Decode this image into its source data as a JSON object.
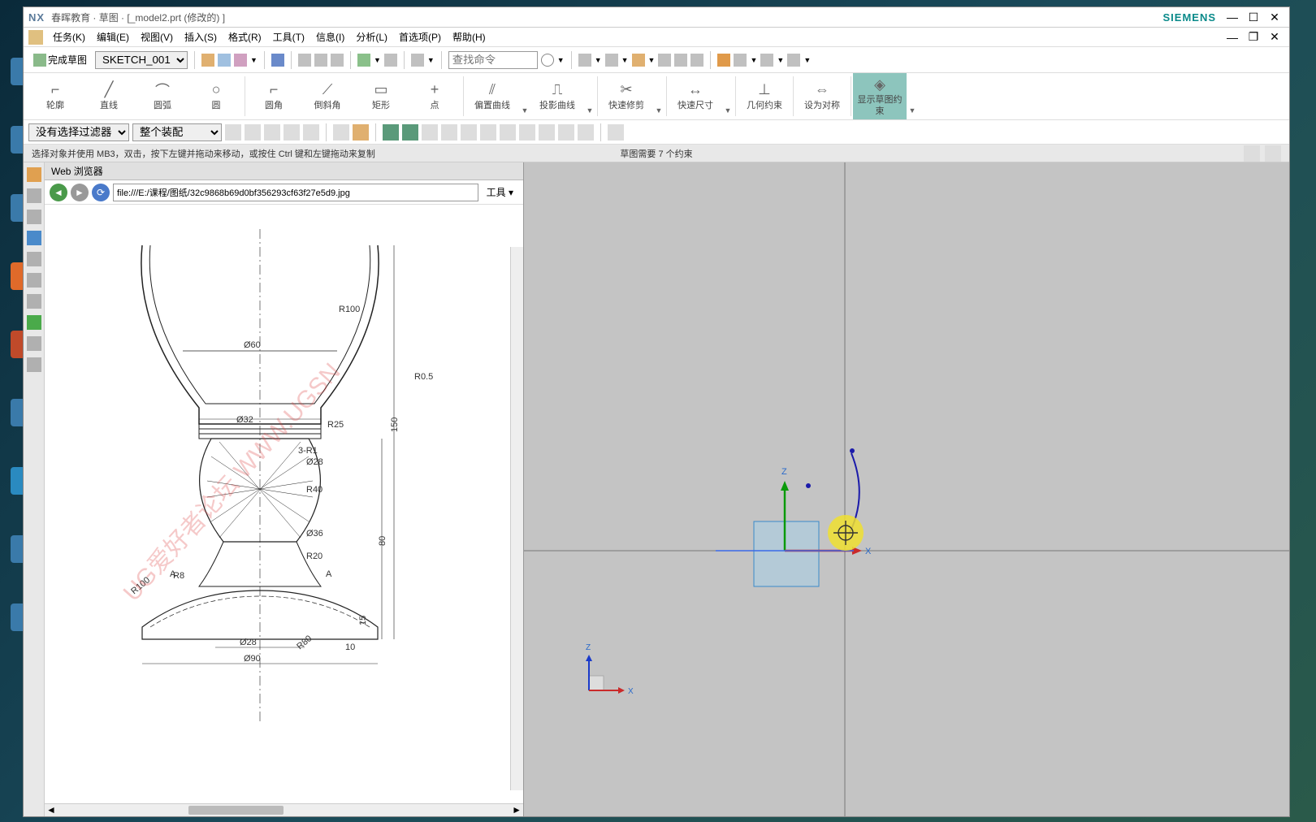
{
  "window": {
    "app_logo": "NX",
    "title": "春晖教育 · 草图 · [_model2.prt  (修改的)  ]",
    "brand": "SIEMENS"
  },
  "menu": {
    "items": [
      "任务(K)",
      "编辑(E)",
      "视图(V)",
      "插入(S)",
      "格式(R)",
      "工具(T)",
      "信息(I)",
      "分析(L)",
      "首选项(P)",
      "帮助(H)"
    ]
  },
  "toolbar1": {
    "finish_sketch": "完成草图",
    "sketch_select_value": "SKETCH_001",
    "cmd_search_placeholder": "查找命令"
  },
  "ribbon": {
    "profile": "轮廓",
    "line": "直线",
    "arc": "圆弧",
    "circle": "圆",
    "fillet": "圆角",
    "chamfer": "倒斜角",
    "rect": "矩形",
    "point": "点",
    "offset": "偏置曲线",
    "project": "投影曲线",
    "trim": "快速修剪",
    "dim": "快速尺寸",
    "geo_constraint": "几何约束",
    "symmetric": "设为对称",
    "show_constraint": "显示草图约束"
  },
  "filter_bar": {
    "filter1": "没有选择过滤器",
    "filter2": "整个装配"
  },
  "hint": {
    "left": "选择对象并使用 MB3，双击，按下左键并拖动来移动，或按住 Ctrl 键和左键拖动来复制",
    "center": "草图需要 7 个约束"
  },
  "left_panel": {
    "title": "Web 浏览器",
    "url": "file:///E:/课程/图纸/32c9868b69d0bf356293cf63f27e5d9.jpg",
    "tools": "工具"
  },
  "drawing_dims": {
    "d60": "Ø60",
    "r100": "R100",
    "r05": "R0.5",
    "d32": "Ø32",
    "r25": "R25",
    "h150": "150",
    "three_r1": "3-R1",
    "d28_top": "Ø28",
    "r40": "R40",
    "d36": "Ø36",
    "r20": "R20",
    "r8": "R8",
    "r100_2": "R100",
    "d28_bot": "Ø28",
    "r80": "R80",
    "ten": "10",
    "d90": "Ø90",
    "h80": "80",
    "h15": "15",
    "a_sec": "A"
  },
  "watermark": "UG爱好者论坛 WWW.UGSN",
  "viewport": {
    "axes": {
      "z": "Z",
      "x": "X"
    },
    "triad": {
      "z": "Z",
      "x": "X"
    }
  }
}
